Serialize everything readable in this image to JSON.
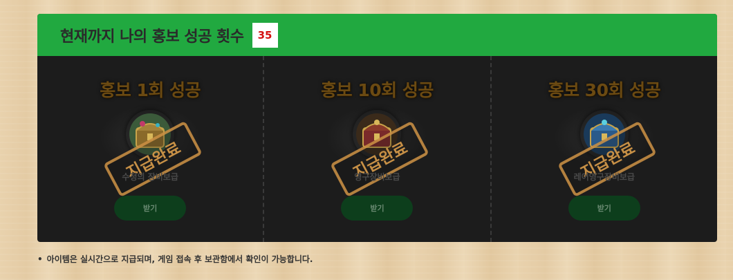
{
  "header": {
    "title": "현재까지 나의 홍보 성공 횟수",
    "count": "35"
  },
  "cards": [
    {
      "title": "홍보 1회 성공",
      "item_name": "수정의 장비보급",
      "stamp": "지급완료",
      "button_label": "받기",
      "icon": "treasure-chest-icon",
      "icon_color": "#8a6a2a"
    },
    {
      "title": "홍보 10회 성공",
      "item_name": "영구장비보급",
      "stamp": "지급완료",
      "button_label": "받기",
      "icon": "treasure-chest-icon",
      "icon_color": "#7a2a2a"
    },
    {
      "title": "홍보 30회 성공",
      "item_name": "레어영구장비보급",
      "stamp": "지급완료",
      "button_label": "받기",
      "icon": "treasure-chest-icon",
      "icon_color": "#2a5a8a"
    }
  ],
  "notice": "아이템은 실시간으로 지급되며, 게임 접속 후 보관함에서 확인이 가능합니다.",
  "colors": {
    "header_bg": "#21a940",
    "panel_bg": "#1c1c1c",
    "count_text": "#d41010",
    "stamp": "#d0944a",
    "button_bg": "#0d3e1c"
  }
}
